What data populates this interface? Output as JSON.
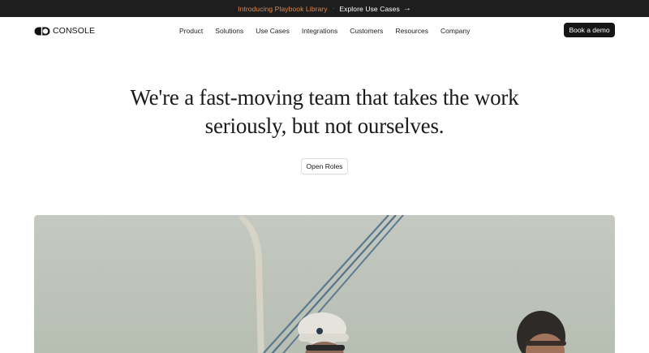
{
  "announcement": {
    "promo": "Introducing Playbook Library",
    "separator": "·",
    "cta": "Explore Use Cases",
    "arrow": "→"
  },
  "brand": {
    "name": "CONSOLE",
    "logo_icon": "console-logo-icon"
  },
  "nav": {
    "items": [
      "Product",
      "Solutions",
      "Use Cases",
      "Integrations",
      "Customers",
      "Resources",
      "Company"
    ],
    "demo_button": "Book a demo"
  },
  "hero": {
    "title_line1": "We're a fast-moving team that takes the work",
    "title_line2": "seriously, but not ourselves.",
    "button": "Open Roles"
  },
  "colors": {
    "announcement_bg": "#1e1e1e",
    "promo_text": "#e0894d",
    "primary_button": "#161616"
  }
}
